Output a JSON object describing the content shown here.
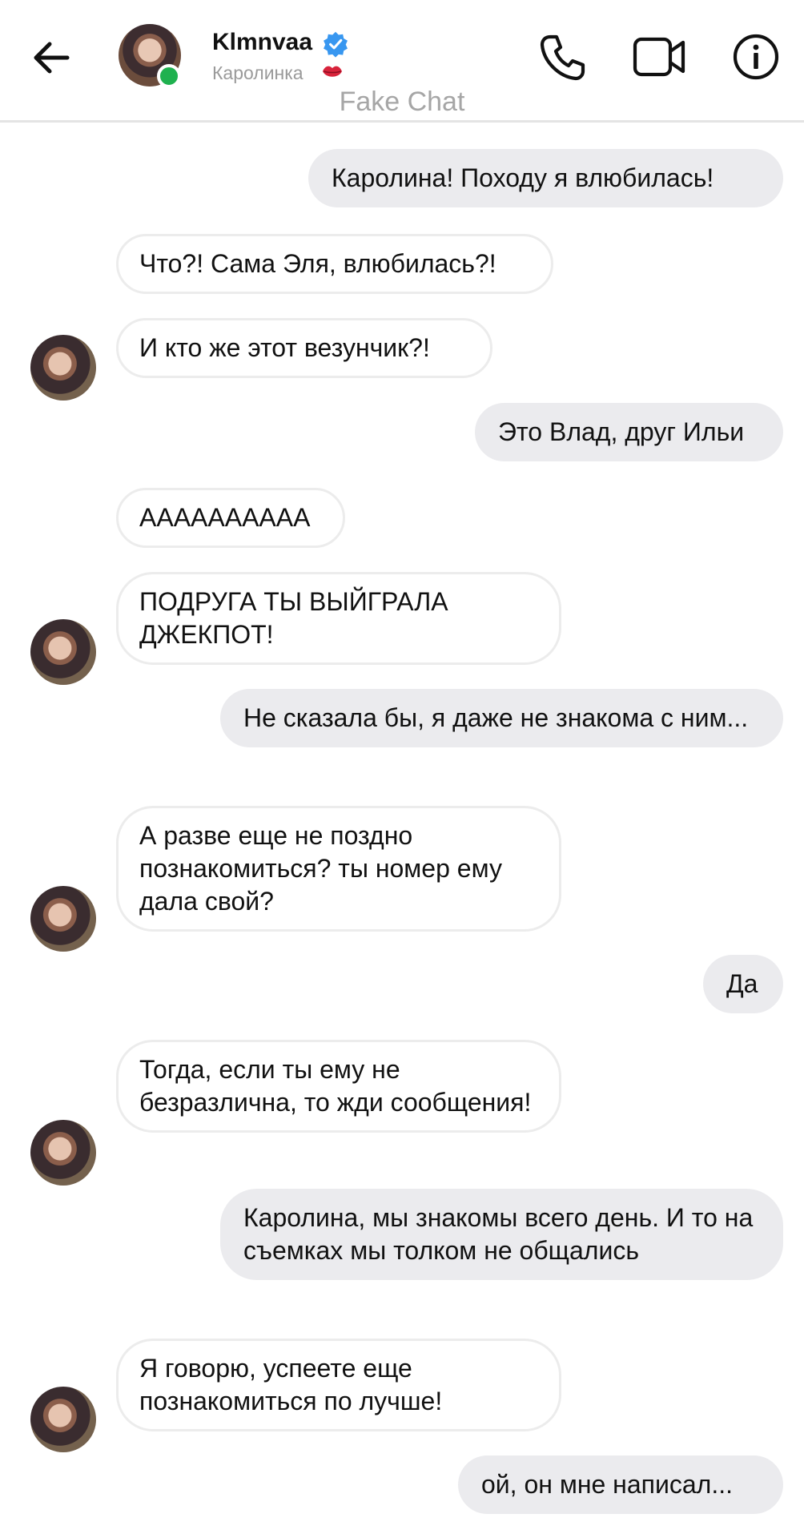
{
  "header": {
    "name": "Klmnvaa",
    "subtitle": "Каролинка",
    "subtitle_emoji_icon": "lips-icon",
    "watermark": "Fake Chat",
    "online": true,
    "accent": "#3897f0",
    "online_color": "#1fb14f"
  },
  "messages": [
    {
      "dir": "out",
      "text": "Каролина! Походу я влюбилась!"
    },
    {
      "dir": "in",
      "text": "Что?! Сама Эля, влюбилась?!"
    },
    {
      "dir": "in",
      "text": "И кто же этот везунчик?!"
    },
    {
      "dir": "out",
      "text": "Это Влад, друг Ильи"
    },
    {
      "dir": "in",
      "text": "АААААААААА"
    },
    {
      "dir": "in",
      "text": "ПОДРУГА ТЫ ВЫЙГРАЛА ДЖЕКПОТ!"
    },
    {
      "dir": "out",
      "text": "Не сказала бы, я даже не знакома с ним..."
    },
    {
      "dir": "in",
      "text": "А разве еще не поздно познакомиться? ты номер ему дала свой?"
    },
    {
      "dir": "out",
      "text": "Да"
    },
    {
      "dir": "in",
      "text": "Тогда, если ты ему не безразлична, то жди сообщения!"
    },
    {
      "dir": "out",
      "text": "Каролина, мы знакомы всего день. И то на съемках мы толком не общались"
    },
    {
      "dir": "in",
      "text": "Я говорю, успеете еще познакомиться по лучше!"
    },
    {
      "dir": "out",
      "text": "ой, он мне написал..."
    }
  ]
}
